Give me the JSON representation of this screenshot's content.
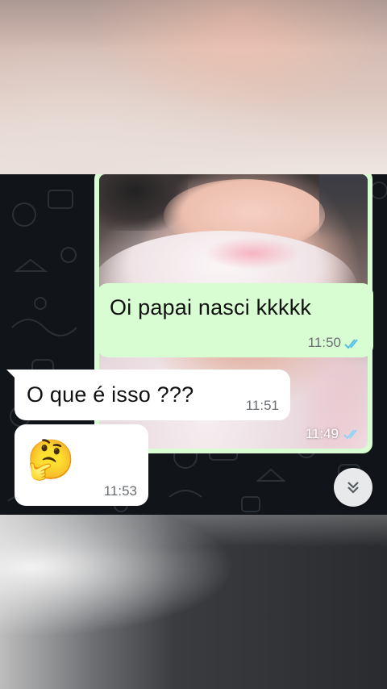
{
  "messages": {
    "image": {
      "time": "11:49"
    },
    "out_text": {
      "text": "Oi papai nasci kkkkk",
      "time": "11:50"
    },
    "in_text": {
      "text": "O que é isso ???",
      "time": "11:51"
    },
    "in_emoji": {
      "emoji": "🤔",
      "time": "11:53"
    }
  },
  "icons": {
    "read_ticks": "double-check-icon",
    "scroll_down": "double-chevron-down-icon",
    "emoji": "thinking-face-emoji"
  },
  "colors": {
    "outgoing_bubble": "#d9fdd3",
    "incoming_bubble": "#ffffff",
    "read_ticks": "#53bdeb",
    "chat_background": "#111418"
  }
}
